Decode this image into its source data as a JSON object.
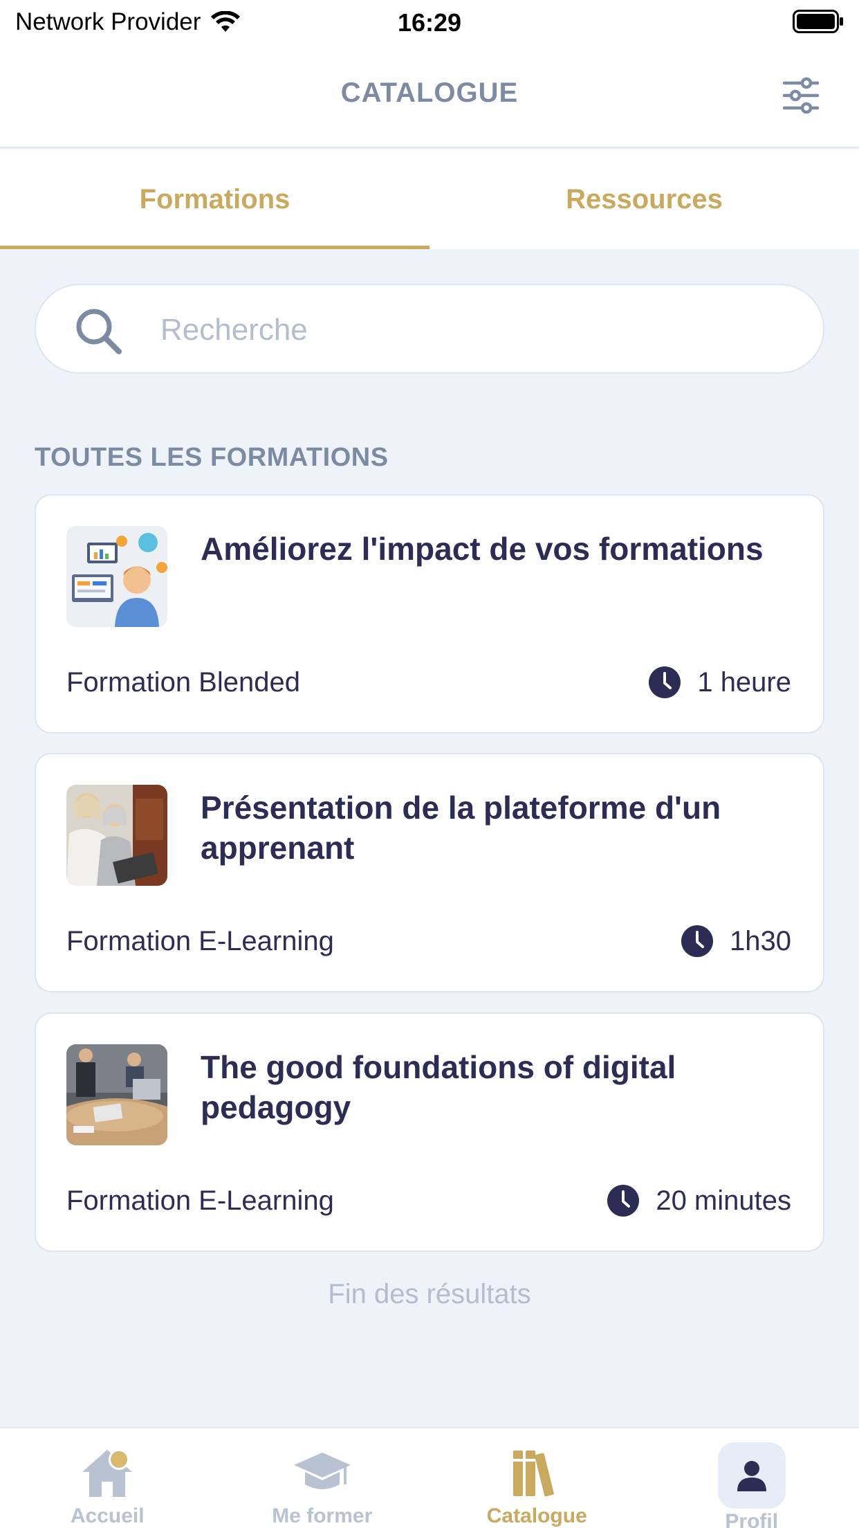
{
  "status_bar": {
    "carrier": "Network Provider",
    "time": "16:29"
  },
  "header": {
    "title": "CATALOGUE",
    "filter_icon": "sliders-icon"
  },
  "tabs": [
    {
      "label": "Formations",
      "active": true
    },
    {
      "label": "Ressources",
      "active": false
    }
  ],
  "search": {
    "placeholder": "Recherche",
    "value": ""
  },
  "section": {
    "title": "TOUTES LES FORMATIONS"
  },
  "courses": [
    {
      "title": "Améliorez l'impact de vos formations",
      "type": "Formation Blended",
      "duration": "1 heure",
      "thumbnail": "illustration-presentation"
    },
    {
      "title": "Présentation de la plateforme d'un apprenant",
      "type": "Formation E-Learning",
      "duration": "1h30",
      "thumbnail": "photo-women-laptop"
    },
    {
      "title": "The good foundations of digital pedagogy",
      "type": "Formation E-Learning",
      "duration": "20 minutes",
      "thumbnail": "photo-meeting-table"
    }
  ],
  "end_of_results": "Fin des résultats",
  "bottom_nav": [
    {
      "label": "Accueil",
      "icon": "home-icon",
      "active": false,
      "has_notification": true
    },
    {
      "label": "Me former",
      "icon": "graduation-cap-icon",
      "active": false
    },
    {
      "label": "Catalogue",
      "icon": "books-icon",
      "active": true
    },
    {
      "label": "Profil",
      "icon": "user-icon",
      "active": false
    }
  ],
  "colors": {
    "accent": "#c8a95e",
    "text_dark": "#2c2c54",
    "muted": "#7d8ba2",
    "background": "#eef3fa"
  }
}
